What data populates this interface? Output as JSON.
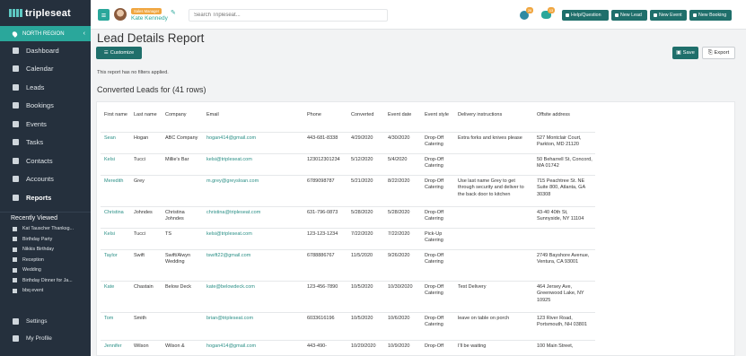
{
  "app": {
    "logo": "tripleseat"
  },
  "sidebar": {
    "region": "NORTH REGION",
    "items": [
      {
        "label": "Dashboard",
        "icon": "dashboard-icon"
      },
      {
        "label": "Calendar",
        "icon": "calendar-icon"
      },
      {
        "label": "Leads",
        "icon": "megaphone-icon"
      },
      {
        "label": "Bookings",
        "icon": "bookmark-icon"
      },
      {
        "label": "Events",
        "icon": "flag-icon"
      },
      {
        "label": "Tasks",
        "icon": "checkbox-icon"
      },
      {
        "label": "Contacts",
        "icon": "users-icon"
      },
      {
        "label": "Accounts",
        "icon": "building-icon"
      },
      {
        "label": "Reports",
        "icon": "bar-chart-icon"
      }
    ],
    "recently_viewed_title": "Recently Viewed",
    "recently_viewed": [
      "Kat Tauscher Thanksg...",
      "Birthday Party",
      "Nikkis Birthday",
      "Reception",
      "Wedding",
      "Birthday Dinner for Ja...",
      "bbq event"
    ],
    "bottom": [
      {
        "label": "Settings",
        "icon": "gear-icon"
      },
      {
        "label": "My Profile",
        "icon": "user-icon"
      }
    ]
  },
  "topbar": {
    "user_badge": "Sales Manager",
    "user_name": "Kate Kennedy",
    "search_placeholder": "Search Tripleseat...",
    "globe_badge": "26",
    "chat_badge": "13",
    "buttons": [
      "Help/Question",
      "New Lead",
      "New Event",
      "New Booking"
    ]
  },
  "page": {
    "title": "Lead Details Report",
    "customize": "Customize",
    "save": "Save",
    "export": "Export",
    "filter_note": "This report has no filters applied.",
    "section_title": "Converted Leads for (41 rows)"
  },
  "table": {
    "headers": [
      "First name",
      "Last name",
      "Company",
      "Email",
      "Phone",
      "Converted",
      "Event date",
      "Event style",
      "Delivery instructions",
      "Offsite address"
    ],
    "rows": [
      [
        "Sean",
        "Hogan",
        "ABC Company",
        "hogan414@gmail.com",
        "443-681-8338",
        "4/29/2020",
        "4/30/2020",
        "Drop-Off Catering",
        "Extra forks and knives please",
        "527 Montclair Court, Parkton, MD 21120"
      ],
      [
        "Kelsi",
        "Tucci",
        "Millie's Bar",
        "kelsi@tripleseat.com",
        "123012301234",
        "5/12/2020",
        "5/4/2020",
        "Drop-Off Catering",
        "",
        "50 Beharrell St, Concord, MA 01742"
      ],
      [
        "Meredith",
        "Grey",
        "",
        "m.grey@greysloan.com",
        "6789098787",
        "5/21/2020",
        "8/22/2020",
        "Drop-Off Catering",
        "Use last name Grey to get through security and deliver to the back door to kitchen",
        "715 Peachtree St. NE Suite 800, Atlanta, GA 30308"
      ],
      [
        "Christina",
        "Johndes",
        "Christina Johndes",
        "christina@tripleseat.com",
        "631-796-0873",
        "5/28/2020",
        "5/28/2020",
        "Drop-Off Catering",
        "",
        "43-40 40th St, Sunnyside, NY 11104"
      ],
      [
        "Kelsi",
        "Tucci",
        "TS",
        "kelsi@tripleseat.com",
        "123-123-1234",
        "7/22/2020",
        "7/22/2020",
        "Pick-Up Catering",
        "",
        ""
      ],
      [
        "Taylor",
        "Swift",
        "Swift/Alwyn Wedding",
        "tswift22@gmail.com",
        "6788886767",
        "11/5/2020",
        "9/26/2020",
        "Drop-Off Catering",
        "",
        "2749 Bayshore Avenue, Ventura, CA 93001"
      ],
      [
        "Kate",
        "Chastain",
        "Below Deck",
        "kate@belowdeck.com",
        "123-456-7890",
        "10/5/2020",
        "10/30/2020",
        "Drop-Off Catering",
        "Test Delivery",
        "464 Jersey Ave, Greenwood Lake, NY 10925"
      ],
      [
        "Tom",
        "Smith",
        "",
        "brian@tripleseat.com",
        "6033616196",
        "10/5/2020",
        "10/6/2020",
        "Drop-Off Catering",
        "leave on table on porch",
        "123 River Road, Portsmouth, NH 03801"
      ],
      [
        "Jennifer",
        "Wilson",
        "Wilson &",
        "hogan414@gmail.com",
        "443-490-",
        "10/20/2020",
        "10/9/2020",
        "Drop-Off",
        "I'll be waiting",
        "100 Main Street,"
      ]
    ]
  }
}
